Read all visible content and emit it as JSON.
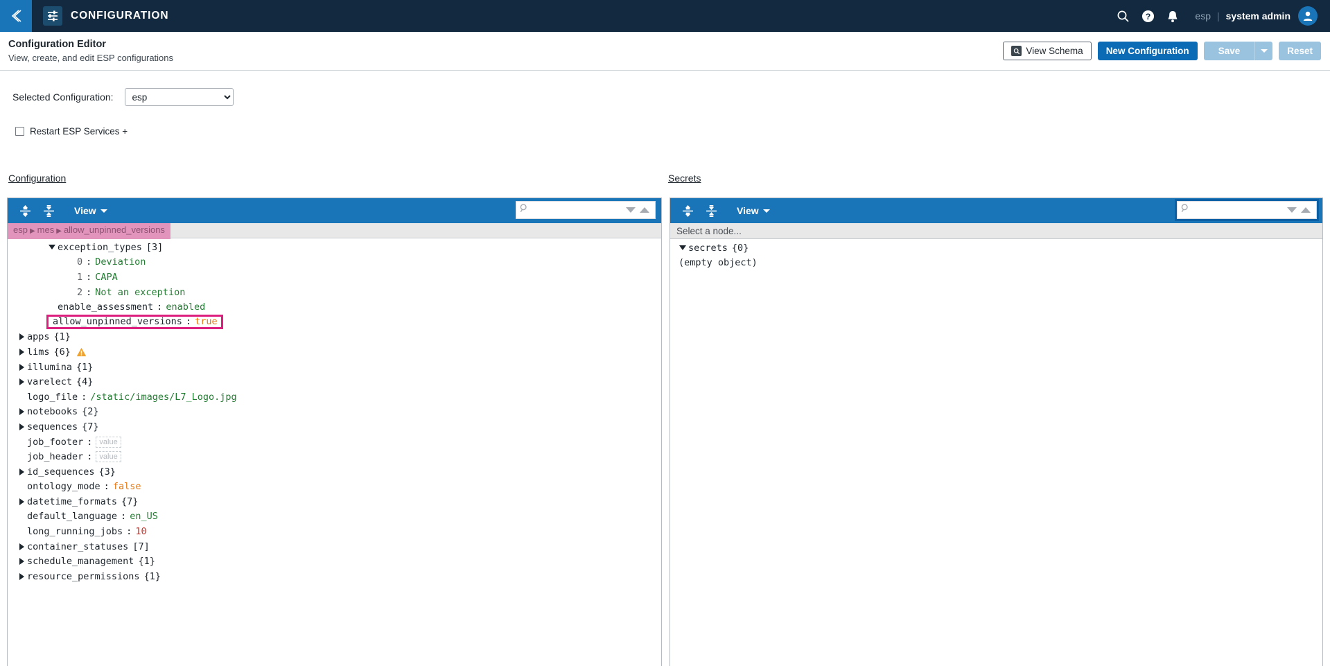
{
  "topbar": {
    "back_icon": "chevron-left-icon",
    "app_icon": "sliders-icon",
    "title": "CONFIGURATION",
    "search_icon": "search-icon",
    "help_icon": "question-circle-icon",
    "bell_icon": "bell-icon",
    "tenant": "esp",
    "separator": "|",
    "user": "system admin",
    "avatar_icon": "user-avatar-icon",
    "bg_color": "#13293f",
    "accent_color": "#1a74b8"
  },
  "page_header": {
    "title": "Configuration Editor",
    "subtitle": "View, create, and edit ESP configurations",
    "view_schema_label": "View Schema",
    "view_schema_icon": "schema-search-icon",
    "new_configuration_label": "New Configuration",
    "save_label": "Save",
    "save_caret_icon": "chevron-down-icon",
    "reset_label": "Reset",
    "primary_color": "#0c6bb5",
    "disabled_color": "#9ac3e0"
  },
  "selection": {
    "label": "Selected Configuration:",
    "selected_value": "esp",
    "options": [
      "esp"
    ]
  },
  "restart": {
    "label": "Restart ESP Services +",
    "checked": false
  },
  "panels": {
    "configuration": {
      "section_label": "Configuration",
      "toolbar": {
        "expand_all_icon": "expand-all-icon",
        "collapse_all_icon": "collapse-all-icon",
        "view_label": "View",
        "view_caret_icon": "chevron-down-icon",
        "search_icon": "search-icon",
        "search_value": "",
        "search_placeholder": "",
        "prev_icon": "triangle-down-icon",
        "next_icon": "triangle-up-icon",
        "focused": false
      },
      "breadcrumb": {
        "parts": [
          "esp",
          "mes",
          "allow_unpinned_versions"
        ],
        "separator": "▶",
        "bg_color": "#e394bd",
        "text_color": "#8d5273"
      },
      "tree": [
        {
          "name": "exception_types",
          "twisty": "down",
          "indent": 2,
          "count": "[3]"
        },
        {
          "name": "0",
          "twisty": "none",
          "indent": 3,
          "value": "Deviation",
          "value_type": "string",
          "index_key": true
        },
        {
          "name": "1",
          "twisty": "none",
          "indent": 3,
          "value": "CAPA",
          "value_type": "string",
          "index_key": true
        },
        {
          "name": "2",
          "twisty": "none",
          "indent": 3,
          "value": "Not an exception",
          "value_type": "string",
          "index_key": true
        },
        {
          "name": "enable_assessment",
          "twisty": "none",
          "indent": 2,
          "value": "enabled",
          "value_type": "string"
        },
        {
          "name": "allow_unpinned_versions",
          "twisty": "none",
          "indent": 2,
          "value": "true",
          "value_type": "bool",
          "highlighted": true
        },
        {
          "name": "apps",
          "twisty": "right",
          "indent": 1,
          "count": "{1}"
        },
        {
          "name": "lims",
          "twisty": "right",
          "indent": 1,
          "count": "{6}",
          "warning": true
        },
        {
          "name": "illumina",
          "twisty": "right",
          "indent": 1,
          "count": "{1}"
        },
        {
          "name": "varelect",
          "twisty": "right",
          "indent": 1,
          "count": "{4}"
        },
        {
          "name": "logo_file",
          "twisty": "none",
          "indent": 1,
          "value": "/static/images/L7_Logo.jpg",
          "value_type": "string"
        },
        {
          "name": "notebooks",
          "twisty": "right",
          "indent": 1,
          "count": "{2}"
        },
        {
          "name": "sequences",
          "twisty": "right",
          "indent": 1,
          "count": "{7}"
        },
        {
          "name": "job_footer",
          "twisty": "none",
          "indent": 1,
          "value": "value",
          "value_type": "empty"
        },
        {
          "name": "job_header",
          "twisty": "none",
          "indent": 1,
          "value": "value",
          "value_type": "empty"
        },
        {
          "name": "id_sequences",
          "twisty": "right",
          "indent": 1,
          "count": "{3}"
        },
        {
          "name": "ontology_mode",
          "twisty": "none",
          "indent": 1,
          "value": "false",
          "value_type": "bool"
        },
        {
          "name": "datetime_formats",
          "twisty": "right",
          "indent": 1,
          "count": "{7}"
        },
        {
          "name": "default_language",
          "twisty": "none",
          "indent": 1,
          "value": "en_US",
          "value_type": "string"
        },
        {
          "name": "long_running_jobs",
          "twisty": "none",
          "indent": 1,
          "value": "10",
          "value_type": "number"
        },
        {
          "name": "container_statuses",
          "twisty": "right",
          "indent": 1,
          "count": "[7]"
        },
        {
          "name": "schedule_management",
          "twisty": "right",
          "indent": 1,
          "count": "{1}"
        },
        {
          "name": "resource_permissions",
          "twisty": "right",
          "indent": 1,
          "count": "{1}"
        }
      ]
    },
    "secrets": {
      "section_label": "Secrets",
      "toolbar": {
        "expand_all_icon": "expand-all-icon",
        "collapse_all_icon": "collapse-all-icon",
        "view_label": "View",
        "view_caret_icon": "chevron-down-icon",
        "search_icon": "search-icon",
        "search_value": "",
        "search_placeholder": "",
        "prev_icon": "triangle-down-icon",
        "next_icon": "triangle-up-icon",
        "focused": true
      },
      "select_node_text": "Select a node...",
      "tree": [
        {
          "name": "secrets",
          "twisty": "down",
          "indent": 0,
          "count": "{0}"
        },
        {
          "name": "(empty object)",
          "twisty": "none",
          "indent": 1,
          "literal": true
        }
      ]
    }
  },
  "colors": {
    "string": "#237d32",
    "boolean": "#e8760c",
    "number": "#d0342c",
    "highlight_border": "#dd1e7e",
    "warning": "#f0a22e"
  }
}
